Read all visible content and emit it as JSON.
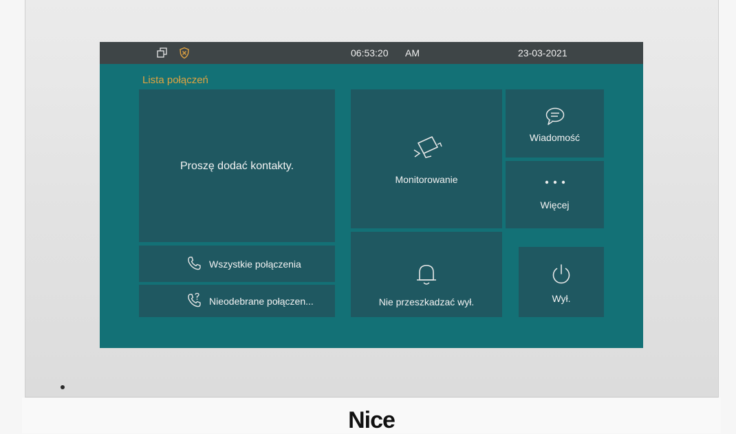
{
  "statusbar": {
    "time": "06:53:20",
    "ampm": "AM",
    "date": "23-03-2021",
    "icons": [
      "windows-icon",
      "shield-icon"
    ]
  },
  "call_list": {
    "title": "Lista połączeń",
    "empty_message": "Proszę dodać kontakty.",
    "all_calls_label": "Wszystkie połączenia",
    "missed_calls_label": "Nieodebrane połączen..."
  },
  "tiles": {
    "monitoring": "Monitorowanie",
    "message": "Wiadomość",
    "more": "Więcej",
    "dnd": "Nie przeszkadzać wył.",
    "off": "Wył."
  },
  "device": {
    "brand": "Nice"
  },
  "colors": {
    "screen_bg": "#137176",
    "tile_bg": "#1f5861",
    "statusbar_bg": "#3e4547",
    "accent": "#e0a341"
  }
}
